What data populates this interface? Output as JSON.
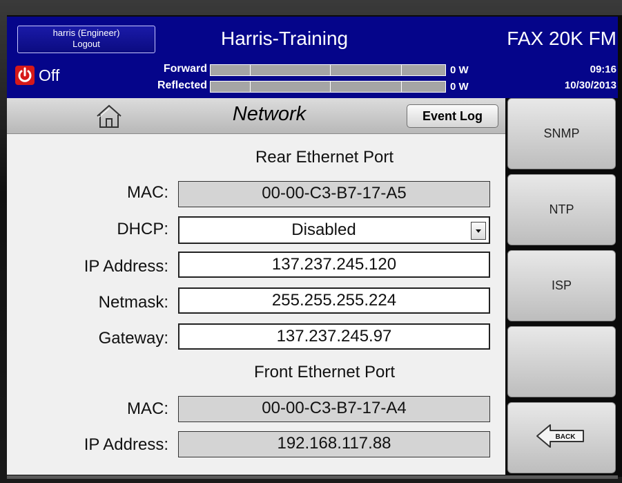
{
  "header": {
    "user": "harris (Engineer)",
    "logout": "Logout",
    "site_name": "Harris-Training",
    "model": "FAX 20K FM"
  },
  "status": {
    "power_state": "Off",
    "forward_label": "Forward",
    "reflected_label": "Reflected",
    "forward_value": "0 W",
    "reflected_value": "0 W",
    "forward_level": 0,
    "reflected_level": 0,
    "time": "09:16",
    "date": "10/30/2013"
  },
  "page": {
    "title": "Network",
    "event_log_label": "Event Log"
  },
  "rear_port": {
    "title": "Rear Ethernet Port",
    "mac_label": "MAC:",
    "mac": "00-00-C3-B7-17-A5",
    "dhcp_label": "DHCP:",
    "dhcp": "Disabled",
    "ip_label": "IP Address:",
    "ip": "137.237.245.120",
    "netmask_label": "Netmask:",
    "netmask": "255.255.255.224",
    "gateway_label": "Gateway:",
    "gateway": "137.237.245.97"
  },
  "front_port": {
    "title": "Front Ethernet Port",
    "mac_label": "MAC:",
    "mac": "00-00-C3-B7-17-A4",
    "ip_label": "IP Address:",
    "ip": "192.168.117.88"
  },
  "side_buttons": {
    "snmp": "SNMP",
    "ntp": "NTP",
    "isp": "ISP",
    "blank": "",
    "back": "BACK"
  },
  "colors": {
    "header_bg": "#05058a",
    "power_red": "#d61919",
    "panel_bg": "#f0f0f0"
  }
}
